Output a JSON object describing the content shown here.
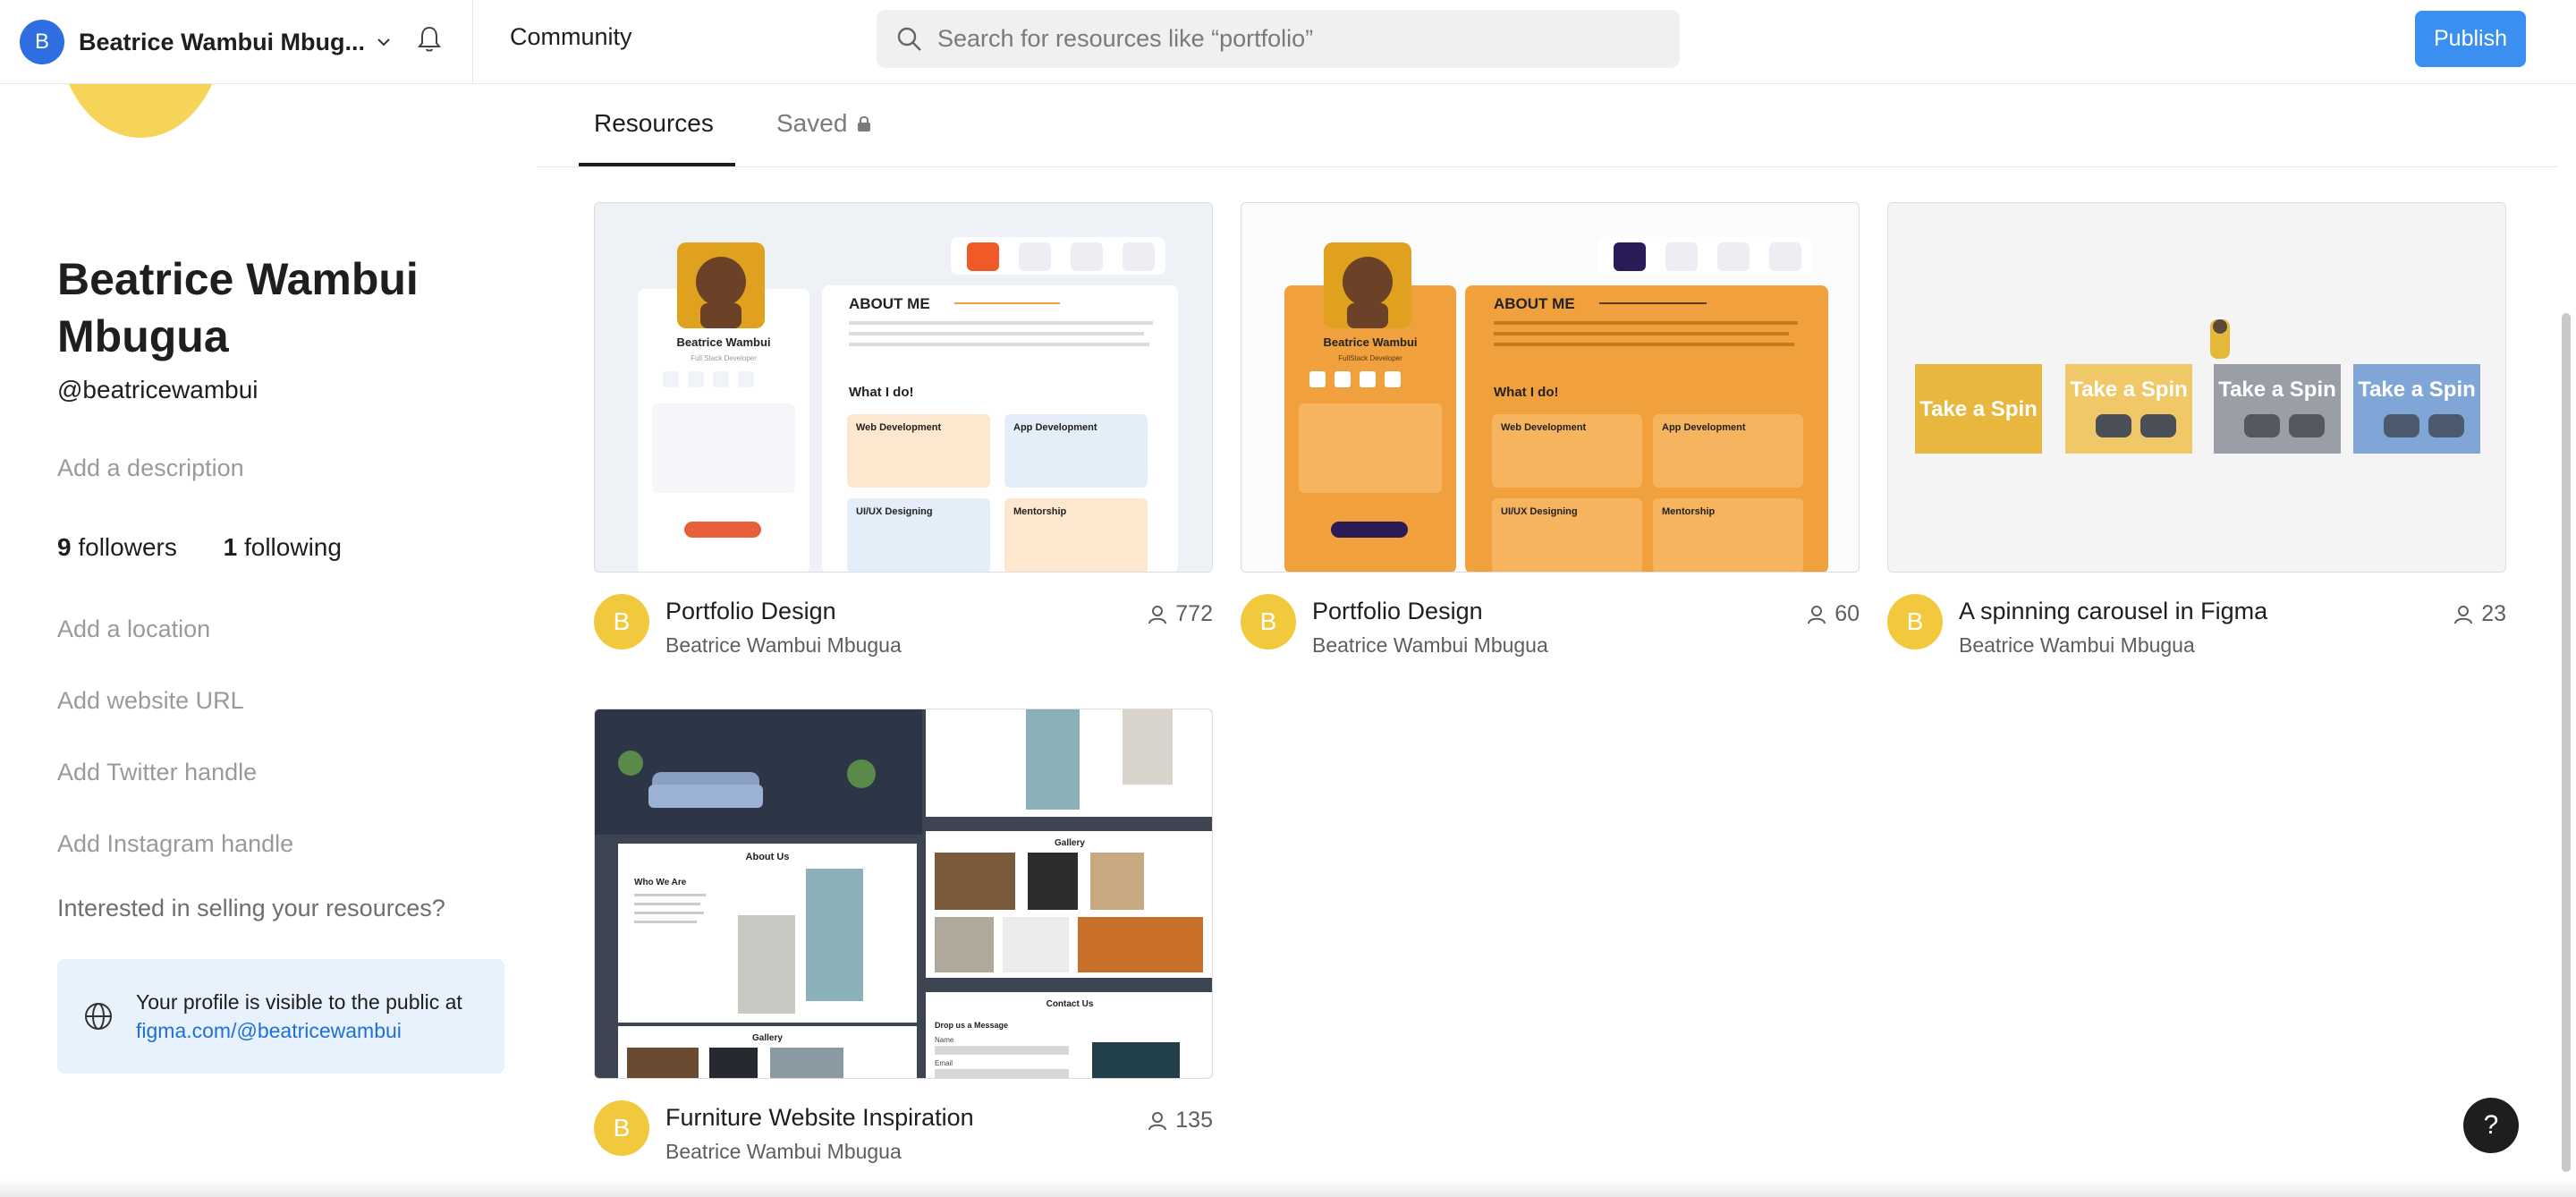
{
  "header": {
    "account_initial": "B",
    "account_name": "Beatrice Wambui Mbug...",
    "community_label": "Community",
    "search_placeholder": "Search for resources like “portfolio”",
    "publish_label": "Publish"
  },
  "tabs": {
    "resources": "Resources",
    "saved": "Saved"
  },
  "profile": {
    "name": "Beatrice Wambui Mbugua",
    "handle": "@beatricewambui",
    "add_description": "Add a description",
    "followers_count": "9",
    "followers_label": "followers",
    "following_count": "1",
    "following_label": "following",
    "add_location": "Add a location",
    "add_website": "Add website URL",
    "add_twitter": "Add Twitter handle",
    "add_instagram": "Add Instagram handle",
    "sell_prompt": "Interested in selling your resources?",
    "visibility_text": "Your profile is visible to the public at",
    "visibility_link": "figma.com/@beatricewambui"
  },
  "cards": [
    {
      "title": "Portfolio Design",
      "author": "Beatrice Wambui Mbugua",
      "users": "772",
      "initial": "B",
      "thumb": {
        "name": "Beatrice Wambui",
        "role": "Full Stack Developer",
        "heading": "ABOUT ME",
        "sub": "What I do!",
        "services": [
          "Web Development",
          "App Development",
          "UI/UX Designing",
          "Mentorship"
        ]
      }
    },
    {
      "title": "Portfolio Design",
      "author": "Beatrice Wambui Mbugua",
      "users": "60",
      "initial": "B",
      "thumb": {
        "name": "Beatrice Wambui",
        "role": "FullStack Developer",
        "heading": "ABOUT ME",
        "sub": "What I do!",
        "services": [
          "Web Development",
          "App Development",
          "UI/UX Designing",
          "Mentorship"
        ]
      }
    },
    {
      "title": "A spinning carousel in Figma",
      "author": "Beatrice Wambui Mbugua",
      "users": "23",
      "initial": "B",
      "thumb": {
        "slide_text": [
          "Take a Spin",
          "Take a Spin",
          "Take a Spin",
          "Take a Spin"
        ]
      }
    },
    {
      "title": "Furniture Website Inspiration",
      "author": "Beatrice Wambui Mbugua",
      "users": "135",
      "initial": "B",
      "thumb": {
        "about": "About Us",
        "who": "Who We Are",
        "gallery": "Gallery",
        "gallery2": "Gallery",
        "contact": "Contact Us",
        "drop": "Drop us a Message",
        "name_label": "Name",
        "email_label": "Email"
      }
    }
  ],
  "help_label": "?",
  "colors": {
    "accent": "#3b8ff0",
    "avatar_yellow": "#f2c93c",
    "profile_blue": "#2f6ee0",
    "orange": "#f0a03c"
  }
}
